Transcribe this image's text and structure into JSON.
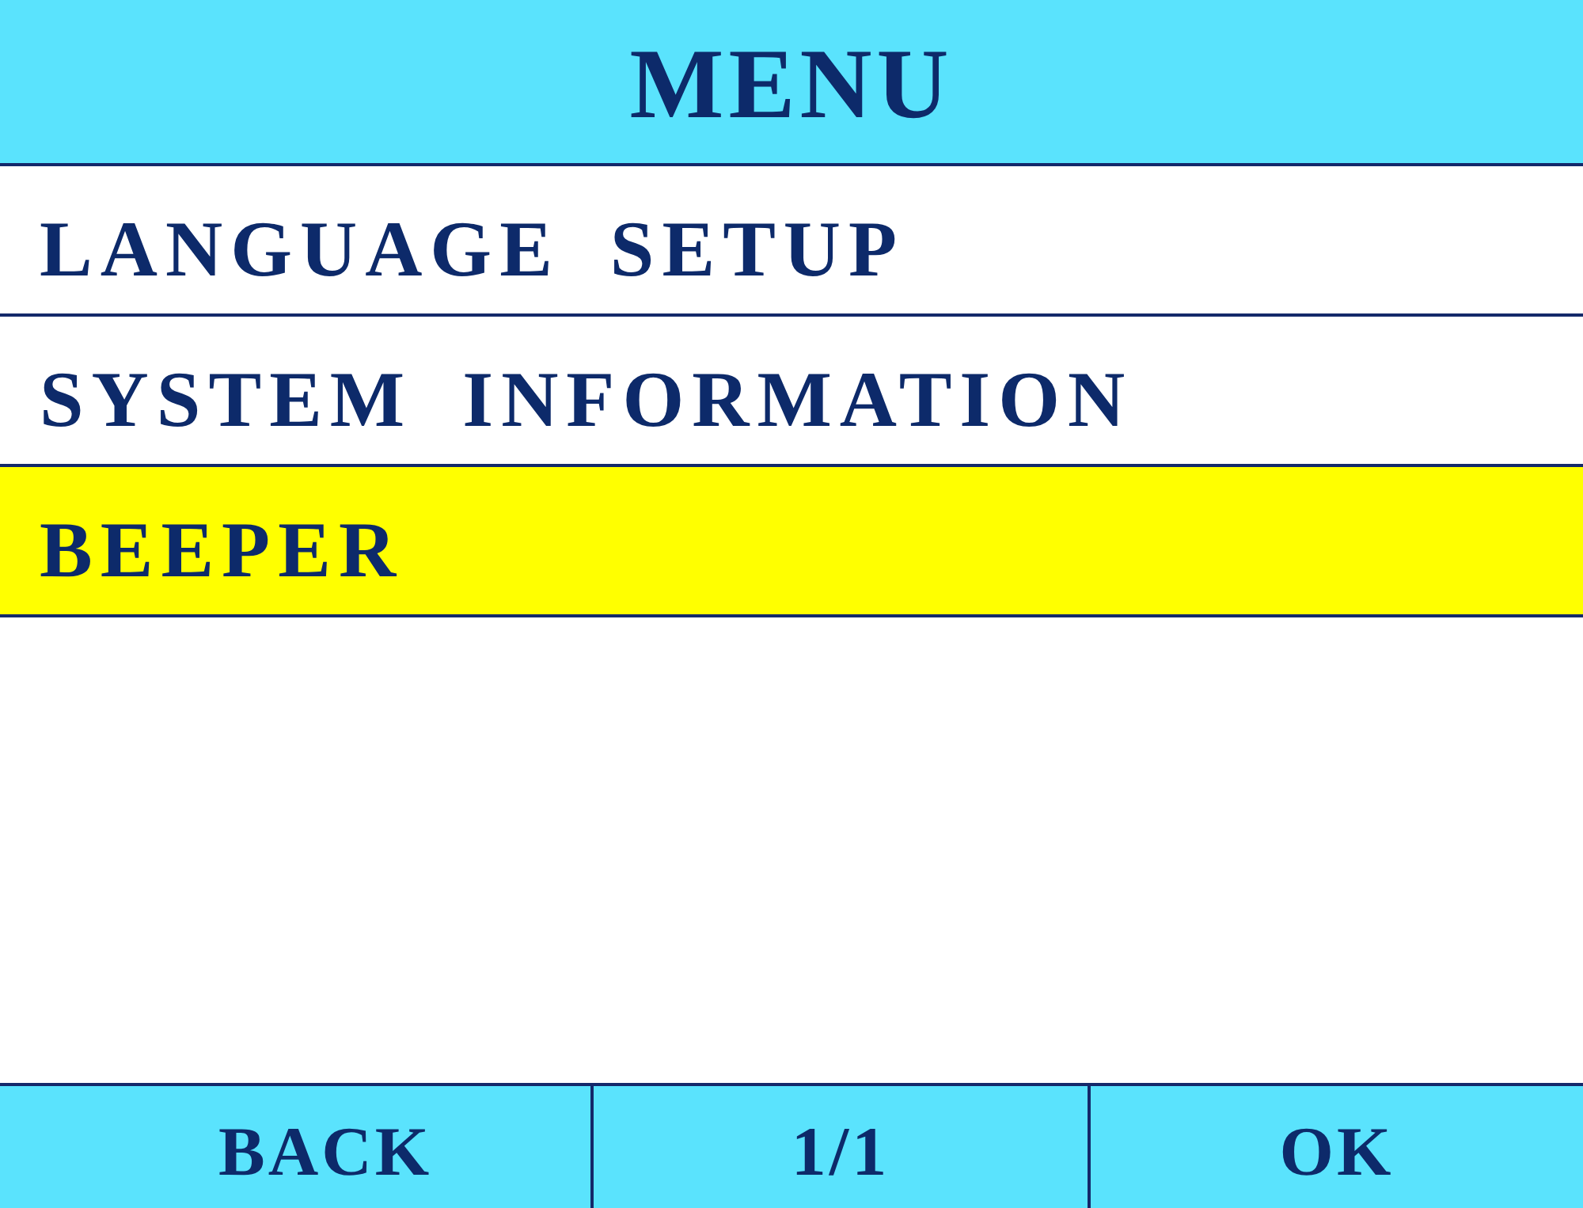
{
  "header": {
    "title": "MENU"
  },
  "menu_items": [
    {
      "label": "LANGUAGE SETUP",
      "selected": false
    },
    {
      "label": "SYSTEM INFORMATION",
      "selected": false
    },
    {
      "label": "BEEPER",
      "selected": true
    }
  ],
  "footer": {
    "back_button": "BACK",
    "page_indicator": "1/1",
    "ok_button": "OK"
  }
}
